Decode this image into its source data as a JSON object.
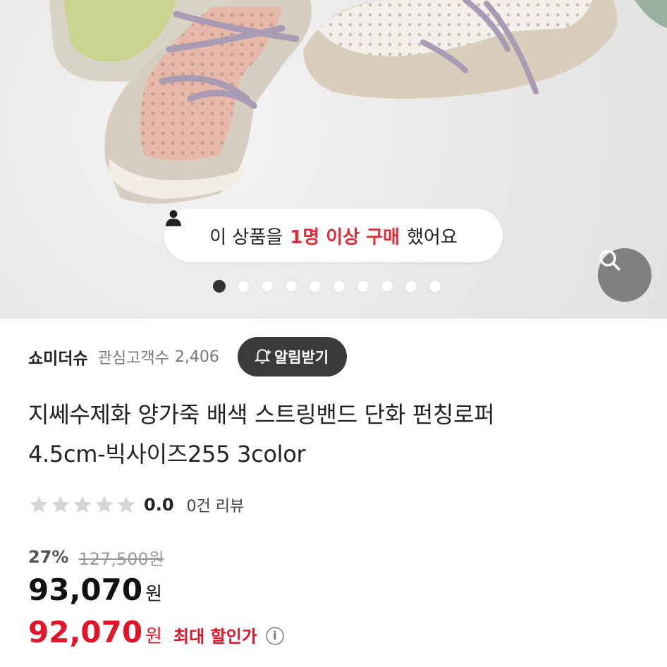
{
  "banner": {
    "purchase_prefix": "이 상품을",
    "purchase_highlight": "1명 이상 구매",
    "purchase_suffix": "했어요",
    "icons": {
      "person": "person-icon",
      "zoom": "search-icon"
    },
    "carousel": {
      "total": 10,
      "active": 1
    }
  },
  "shop": {
    "name": "쇼미더슈",
    "interest_label": "관심고객수",
    "interest_count": "2,406",
    "notify_label": "알림받기"
  },
  "product": {
    "title_line1": "지쎄수제화 양가죽 배색 스트링밴드 단화 펀칭로퍼",
    "title_line2": "4.5cm-빅사이즈255 3color"
  },
  "rating": {
    "score": "0.0",
    "review_text": "0건 리뷰",
    "stars_filled": 0,
    "stars_total": 5
  },
  "pricing": {
    "discount_rate": "27%",
    "original_price": "127,500원",
    "price": "93,070",
    "currency": "원",
    "max_discount_price": "92,070",
    "max_discount_label": "최대 할인가"
  },
  "colors": {
    "accent_red": "#e1142a",
    "notify_bg": "#3b3b3b"
  }
}
